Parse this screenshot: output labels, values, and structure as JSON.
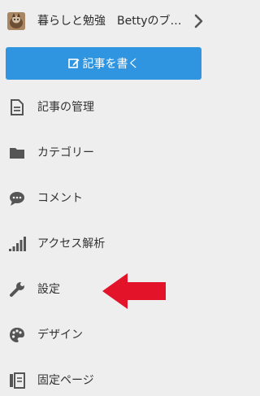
{
  "header": {
    "blog_title": "暮らしと勉強　Bettyのブ…",
    "avatar_icon": "cat-avatar"
  },
  "write_button": {
    "label": "記事を書く",
    "icon": "edit-icon",
    "color": "#2f95e0"
  },
  "menu": [
    {
      "label": "記事の管理",
      "icon": "document-icon"
    },
    {
      "label": "カテゴリー",
      "icon": "folder-icon"
    },
    {
      "label": "コメント",
      "icon": "comment-icon"
    },
    {
      "label": "アクセス解析",
      "icon": "signal-bars-icon"
    },
    {
      "label": "設定",
      "icon": "wrench-icon"
    },
    {
      "label": "デザイン",
      "icon": "palette-icon"
    },
    {
      "label": "固定ページ",
      "icon": "pages-icon"
    }
  ],
  "annotation": {
    "icon": "red-arrow",
    "color": "#e3142a"
  }
}
